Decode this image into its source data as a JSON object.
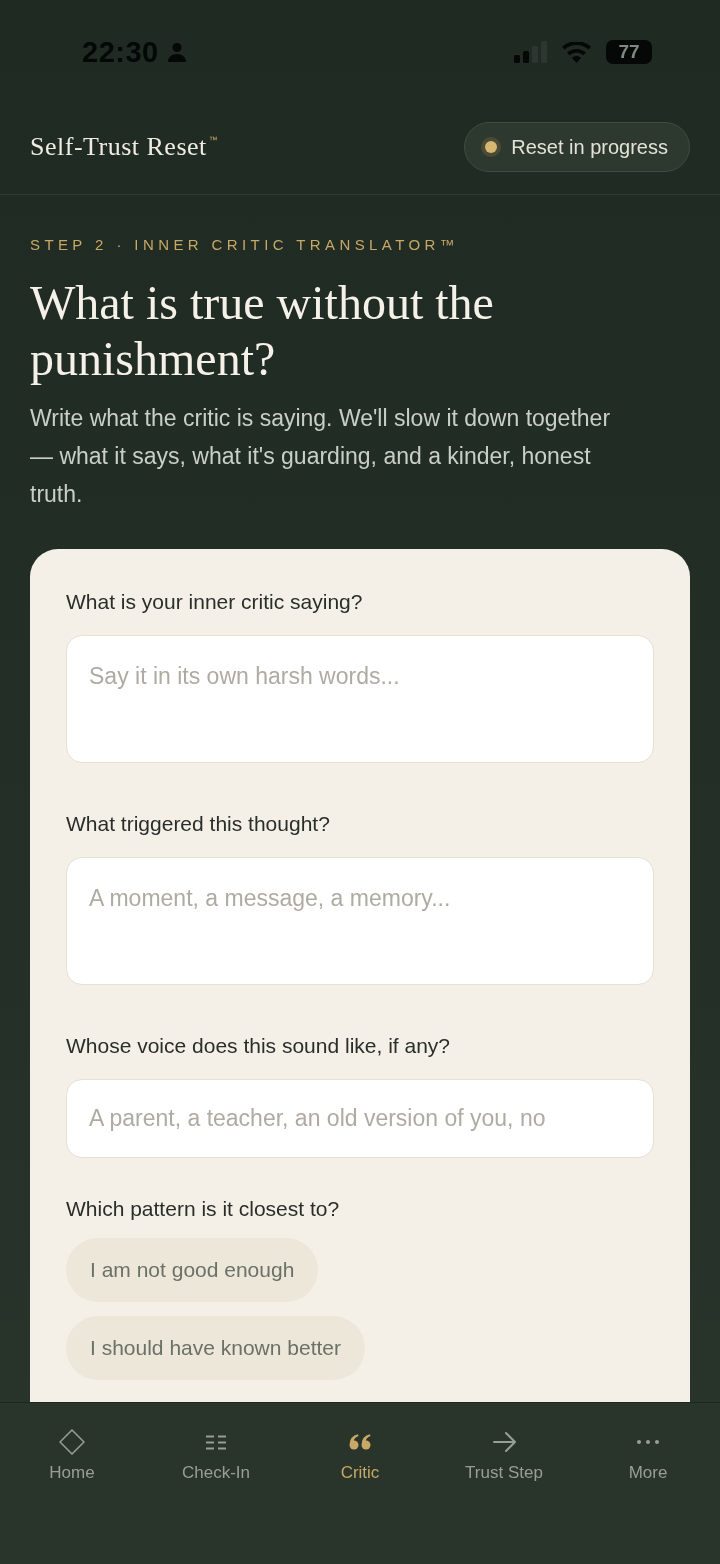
{
  "status_bar": {
    "time": "22:30",
    "battery": "77"
  },
  "header": {
    "title": "Self-Trust Reset$^{™}$",
    "badge": "Reset in progress"
  },
  "intro": {
    "step": "STEP 2 · INNER CRITIC TRANSLATOR™",
    "title": "What is true without the punishment?",
    "subtitle": "Write what the critic is saying. We'll slow it down together — what it says, what it's guarding, and a kinder, honest truth."
  },
  "form": {
    "fields": [
      {
        "kind": "textarea",
        "label": "What is your inner critic saying?",
        "placeholder": "Say it in its own harsh words..."
      },
      {
        "kind": "textarea",
        "label": "What triggered this thought?",
        "placeholder": "A moment, a message, a memory..."
      },
      {
        "kind": "input",
        "label": "Whose voice does this sound like, if any?",
        "placeholder": "A parent, a teacher, an old version of you, no"
      }
    ],
    "pattern": {
      "label": "Which pattern is it closest to?",
      "options": [
        {
          "label": "I am not good enough",
          "selected": false
        },
        {
          "label": "I should have known better",
          "selected": false
        }
      ]
    }
  },
  "nav": [
    {
      "label": "Home",
      "selected": false
    },
    {
      "label": "Check-In",
      "selected": false
    },
    {
      "label": "Critic",
      "selected": true
    },
    {
      "label": "Trust Step",
      "selected": false
    },
    {
      "label": "More",
      "selected": false
    }
  ]
}
